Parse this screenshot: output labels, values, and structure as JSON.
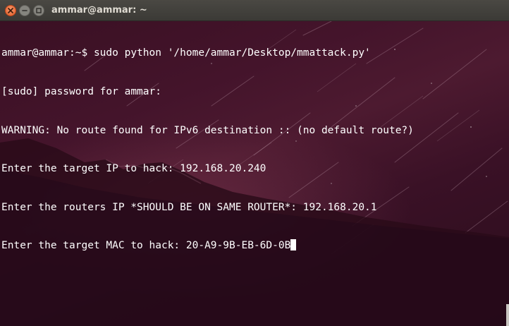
{
  "window": {
    "title": "ammar@ammar: ~",
    "controls": {
      "close_icon": "close-icon",
      "minimize_icon": "minimize-icon",
      "maximize_icon": "maximize-icon"
    },
    "colors": {
      "titlebar": "#3b3a36",
      "close_button": "#e35b24",
      "terminal_text": "#ffffff",
      "terminal_background": "#3a1023"
    }
  },
  "terminal": {
    "lines": [
      "ammar@ammar:~$ sudo python '/home/ammar/Desktop/mmattack.py'",
      "[sudo] password for ammar:",
      "WARNING: No route found for IPv6 destination :: (no default route?)",
      "Enter the target IP to hack: 192.168.20.240",
      "Enter the routers IP *SHOULD BE ON SAME ROUTER*: 192.168.20.1",
      "Enter the target MAC to hack: 20-A9-9B-EB-6D-0B"
    ]
  }
}
